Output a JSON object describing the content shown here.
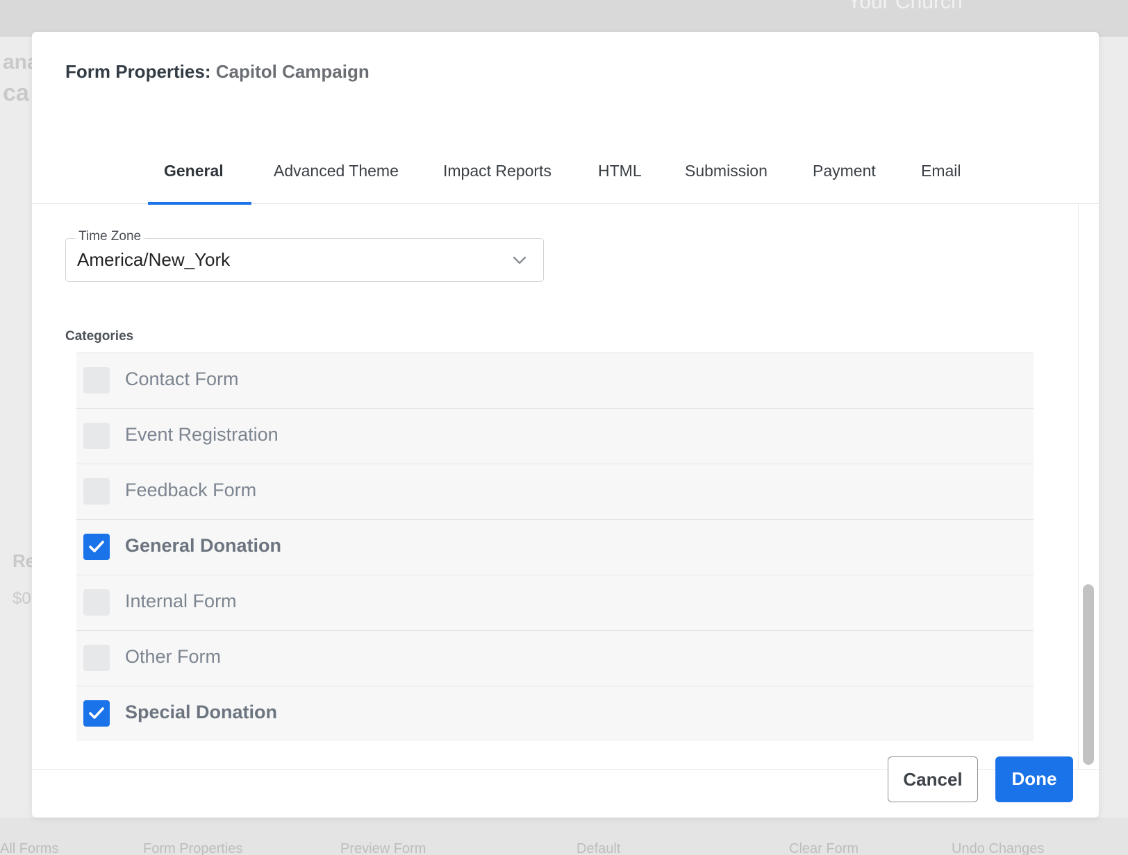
{
  "background": {
    "church_text": "Your Church",
    "bottom_bar": [
      "All Forms",
      "Form Properties",
      "Preview Form",
      "Default",
      "Clear Form",
      "Undo Changes"
    ]
  },
  "modal": {
    "title_prefix": "Form Properties:",
    "title_name": "Capitol Campaign",
    "tabs": [
      {
        "label": "General",
        "active": true
      },
      {
        "label": "Advanced Theme",
        "active": false
      },
      {
        "label": "Impact Reports",
        "active": false
      },
      {
        "label": "HTML",
        "active": false
      },
      {
        "label": "Submission",
        "active": false
      },
      {
        "label": "Payment",
        "active": false
      },
      {
        "label": "Email",
        "active": false
      }
    ],
    "time_zone": {
      "label": "Time Zone",
      "value": "America/New_York"
    },
    "categories": {
      "heading": "Categories",
      "items": [
        {
          "label": "Contact Form",
          "checked": false
        },
        {
          "label": "Event Registration",
          "checked": false
        },
        {
          "label": "Feedback Form",
          "checked": false
        },
        {
          "label": "General Donation",
          "checked": true
        },
        {
          "label": "Internal Form",
          "checked": false
        },
        {
          "label": "Other Form",
          "checked": false
        },
        {
          "label": "Special Donation",
          "checked": true
        }
      ]
    },
    "buttons": {
      "cancel": "Cancel",
      "done": "Done"
    }
  },
  "colors": {
    "accent": "#1a73e8",
    "checkbox_off": "#e7e8ea",
    "row_bg": "#f7f7f8"
  },
  "icons": [
    "chevron-down-icon",
    "check-icon"
  ]
}
